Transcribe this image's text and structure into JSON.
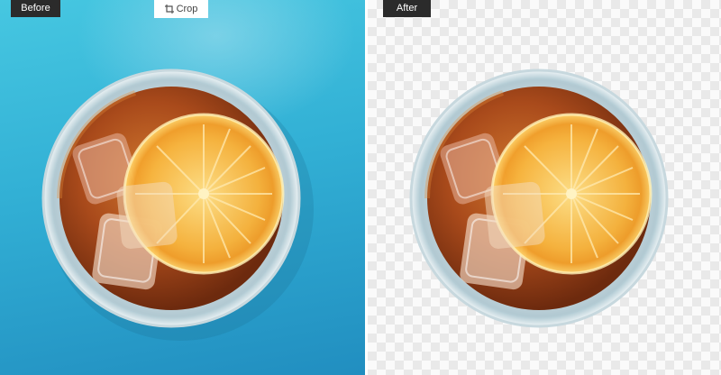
{
  "labels": {
    "before": "Before",
    "after": "After"
  },
  "toolbar": {
    "crop_label": "Crop",
    "crop_icon": "crop-icon"
  },
  "photo": {
    "subject": "iced tea with lemon slice and ice cubes in glass",
    "before_background": "blue",
    "after_background": "transparent"
  },
  "colors": {
    "label_bg": "#2b2b2b",
    "before_bg": "#35b4d8",
    "tea": "#a8481a",
    "lemon": "#f7b43c"
  }
}
